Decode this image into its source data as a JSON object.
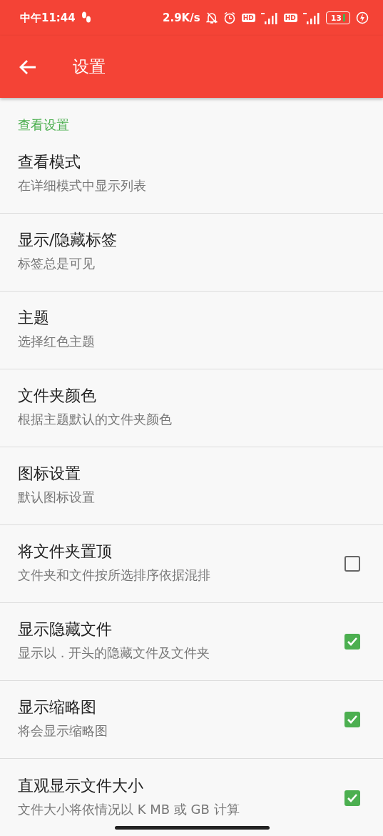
{
  "status_bar": {
    "time": "中午11:44",
    "speed": "2.9K/s",
    "hd_badges": [
      "HD",
      "HD"
    ],
    "battery": "13"
  },
  "toolbar": {
    "title": "设置"
  },
  "section": {
    "title": "查看设置"
  },
  "rows": [
    {
      "kind": "plain",
      "title": "查看模式",
      "subtitle": "在详细模式中显示列表"
    },
    {
      "kind": "plain",
      "title": "显示/隐藏标签",
      "subtitle": "标签总是可见"
    },
    {
      "kind": "plain",
      "title": "主题",
      "subtitle": "选择红色主题"
    },
    {
      "kind": "plain",
      "title": "文件夹颜色",
      "subtitle": "根据主题默认的文件夹颜色"
    },
    {
      "kind": "plain",
      "title": "图标设置",
      "subtitle": "默认图标设置"
    },
    {
      "kind": "checkbox",
      "title": "将文件夹置顶",
      "subtitle": "文件夹和文件按所选排序依据混排",
      "checked": false
    },
    {
      "kind": "checkbox",
      "title": "显示隐藏文件",
      "subtitle": "显示以 . 开头的隐藏文件及文件夹",
      "checked": true
    },
    {
      "kind": "checkbox",
      "title": "显示缩略图",
      "subtitle": "将会显示缩略图",
      "checked": true
    },
    {
      "kind": "checkbox",
      "title": "直观显示文件大小",
      "subtitle": "文件大小将依情况以 K MB 或 GB 计算",
      "checked": true
    }
  ]
}
